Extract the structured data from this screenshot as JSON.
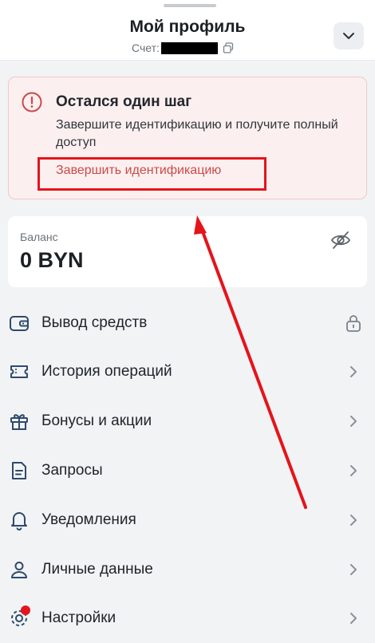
{
  "header": {
    "title": "Мой профиль",
    "account_label": "Счет:",
    "icons": {
      "copy": "copy-icon",
      "chevron": "chevron-down-icon"
    }
  },
  "alert": {
    "title": "Остался один шаг",
    "text": "Завершите идентификацию и получите полный доступ",
    "link": "Завершить идентификацию",
    "icon": "alert-circle-icon"
  },
  "balance": {
    "label": "Баланс",
    "value": "0 BYN",
    "icon": "eye-off-icon"
  },
  "menu": [
    {
      "label": "Вывод средств",
      "icon": "wallet-icon",
      "right": "lock-icon"
    },
    {
      "label": "История операций",
      "icon": "ticket-icon",
      "right": "chevron-right-icon"
    },
    {
      "label": "Бонусы и акции",
      "icon": "gift-icon",
      "right": "chevron-right-icon"
    },
    {
      "label": "Запросы",
      "icon": "document-icon",
      "right": "chevron-right-icon"
    },
    {
      "label": "Уведомления",
      "icon": "bell-icon",
      "right": "chevron-right-icon"
    },
    {
      "label": "Личные данные",
      "icon": "user-icon",
      "right": "chevron-right-icon"
    },
    {
      "label": "Настройки",
      "icon": "gear-icon",
      "right": "chevron-right-icon"
    }
  ],
  "colors": {
    "accent_red": "#cc4a4a",
    "annotation_red": "#e5141b",
    "alert_bg": "#fcefef",
    "page_bg": "#f1f3f5"
  }
}
